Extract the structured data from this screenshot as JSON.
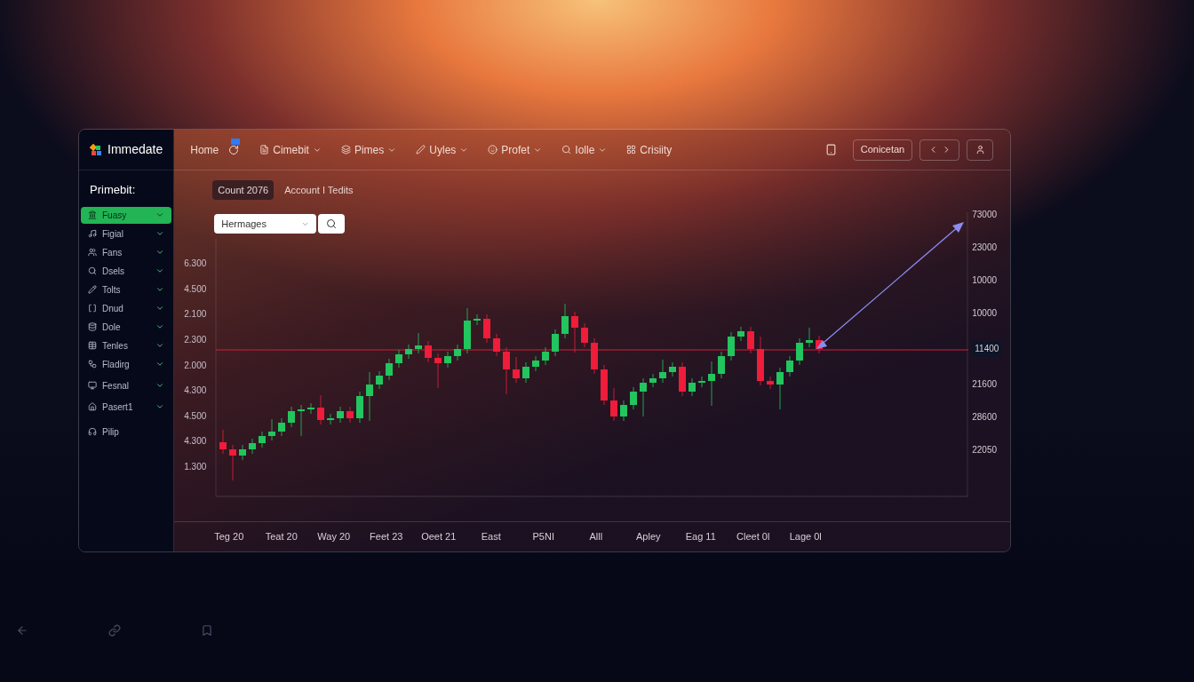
{
  "app": {
    "logo": "Immedate"
  },
  "nav": {
    "items": [
      {
        "label": "Home",
        "has_menu": false
      },
      {
        "label": "Cimebit",
        "has_menu": true
      },
      {
        "label": "Pimes",
        "has_menu": true
      },
      {
        "label": "Uyles",
        "has_menu": true
      },
      {
        "label": "Profet",
        "has_menu": true
      },
      {
        "label": "Iolle",
        "has_menu": true
      },
      {
        "label": "Crisiity",
        "has_menu": false
      }
    ]
  },
  "actions": {
    "button": "Conicetan"
  },
  "sidebar": {
    "title": "Primebit:",
    "items": [
      {
        "label": "Fuasy",
        "selected": true,
        "expandable": true
      },
      {
        "label": "Figial",
        "selected": false,
        "expandable": true
      },
      {
        "label": "Fans",
        "selected": false,
        "expandable": true
      },
      {
        "label": "Dsels",
        "selected": false,
        "expandable": true
      },
      {
        "label": "Tolts",
        "selected": false,
        "expandable": true
      },
      {
        "label": "Dnud",
        "selected": false,
        "expandable": true
      },
      {
        "label": "Dole",
        "selected": false,
        "expandable": true
      },
      {
        "label": "Tenles",
        "selected": false,
        "expandable": true
      },
      {
        "label": "Fladirg",
        "selected": false,
        "expandable": true
      },
      {
        "label": "Fesnal",
        "selected": false,
        "expandable": true
      },
      {
        "label": "Pasert1",
        "selected": false,
        "expandable": true
      },
      {
        "label": "Pilip",
        "selected": false,
        "expandable": false
      }
    ]
  },
  "chart_header": {
    "count_chip": "Count 2076",
    "account_label": "Account I Tedits"
  },
  "symbol_select": {
    "value": "Hermages"
  },
  "chart": {
    "left_axis_labels": [
      "6.300",
      "4.500",
      "2.100",
      "2.300",
      "2.000",
      "4.300",
      "4.500",
      "4.300",
      "1.300"
    ],
    "right_axis_labels": [
      {
        "label": "73000",
        "current": false
      },
      {
        "label": "23000",
        "current": false
      },
      {
        "label": "10000",
        "current": false
      },
      {
        "label": "10000",
        "current": false
      },
      {
        "label": "11400",
        "current": true
      },
      {
        "label": "21600",
        "current": false
      },
      {
        "label": "28600",
        "current": false
      },
      {
        "label": "22050",
        "current": false
      }
    ],
    "x_axis_labels": [
      "Teg 20",
      "Teat 20",
      "Way 20",
      "Feet 23",
      "Oeet 21",
      "East",
      "P5NI",
      "Alll",
      "Apley",
      "Eag 11",
      "Cleet 0l",
      "Lage 0l"
    ]
  }
}
